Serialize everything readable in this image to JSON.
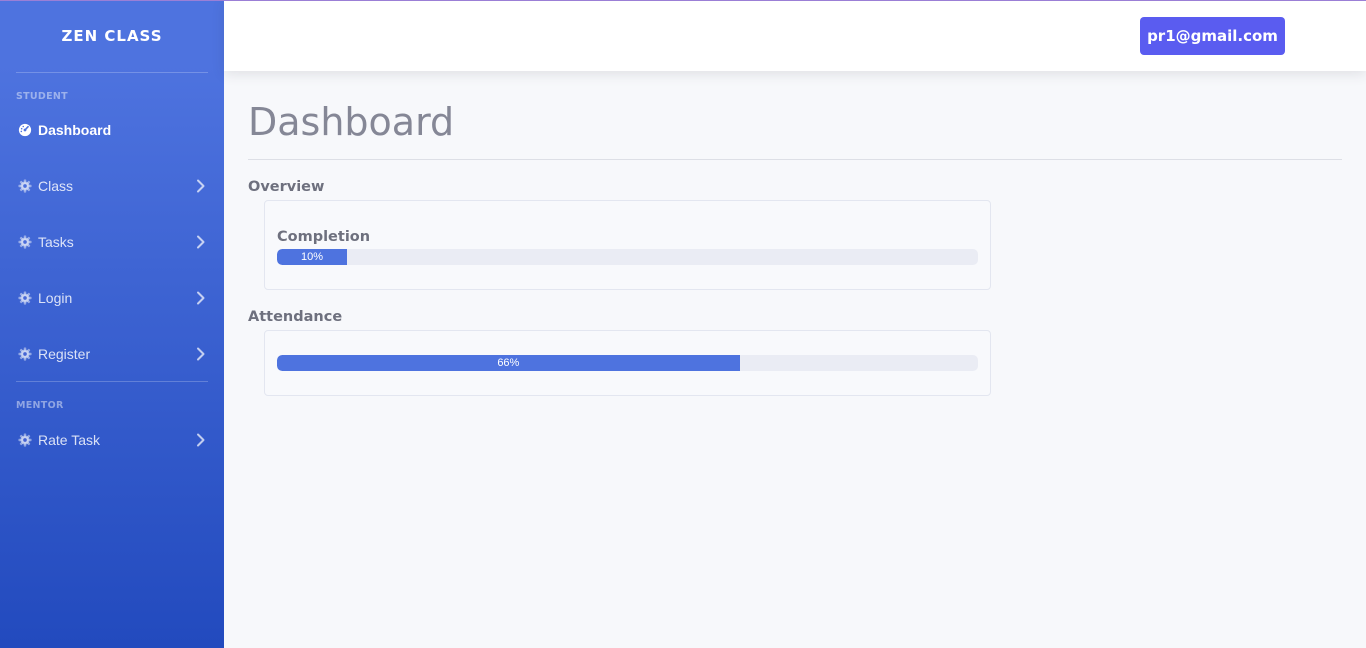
{
  "sidebar": {
    "brand": "ZEN CLASS",
    "sections": [
      {
        "heading": "STUDENT",
        "items": [
          {
            "label": "Dashboard",
            "icon": "tachometer-icon",
            "active": true,
            "has_chevron": false
          },
          {
            "label": "Class",
            "icon": "gear-icon",
            "active": false,
            "has_chevron": true
          },
          {
            "label": "Tasks",
            "icon": "gear-icon",
            "active": false,
            "has_chevron": true
          },
          {
            "label": "Login",
            "icon": "gear-icon",
            "active": false,
            "has_chevron": true
          },
          {
            "label": "Register",
            "icon": "gear-icon",
            "active": false,
            "has_chevron": true
          }
        ]
      },
      {
        "heading": "MENTOR",
        "items": [
          {
            "label": "Rate Task",
            "icon": "gear-icon",
            "active": false,
            "has_chevron": true
          }
        ]
      }
    ]
  },
  "topbar": {
    "user_email": "pr1@gmail.com"
  },
  "main": {
    "title": "Dashboard",
    "overview": {
      "heading": "Overview",
      "label": "Completion",
      "progress_text": "10%",
      "progress_value": 10
    },
    "attendance": {
      "heading": "Attendance",
      "progress_text": "66%",
      "progress_value": 66
    }
  },
  "colors": {
    "sidebar_top": "#4e73df",
    "sidebar_bottom": "#224abe",
    "user_button": "#5a5cf0",
    "progress_fill": "#4e73df",
    "progress_track": "#eaecf4"
  }
}
